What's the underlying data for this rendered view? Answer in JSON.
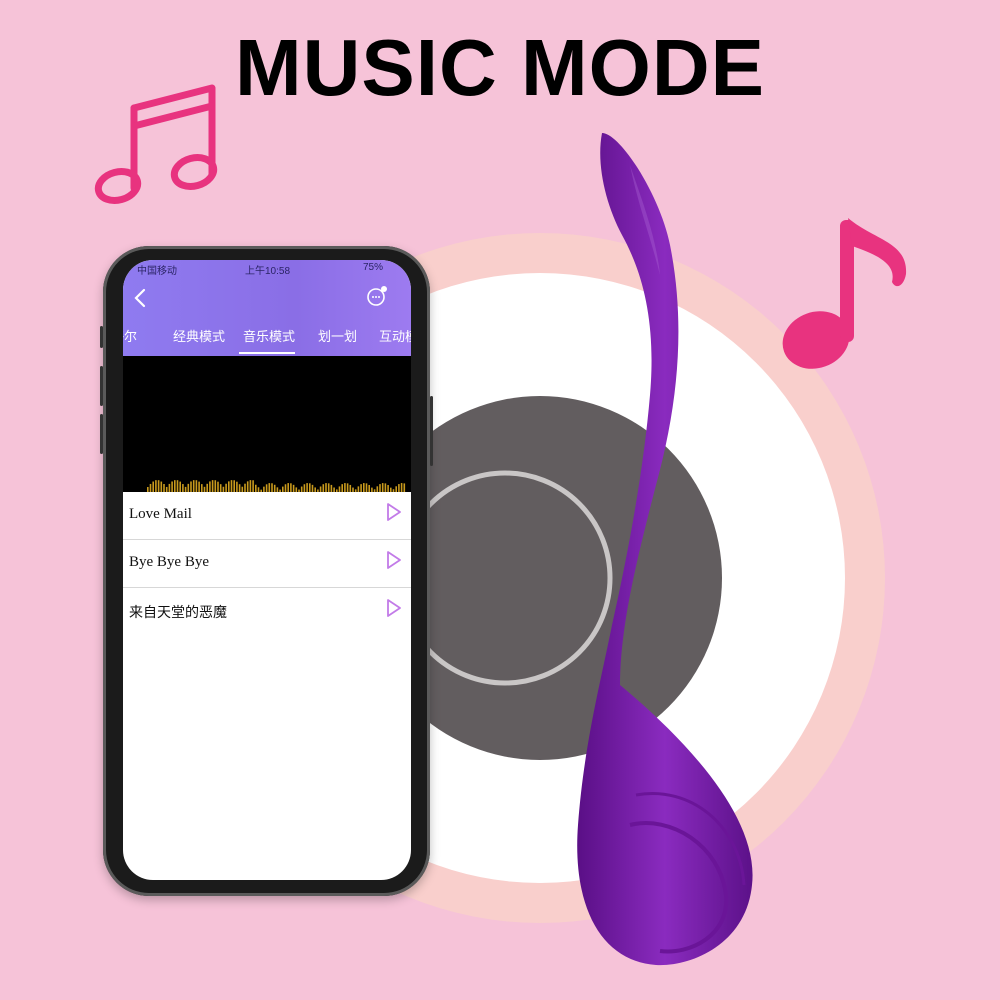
{
  "headline": "MUSIC MODE",
  "icons": {
    "note_left": "beamed-eighth-notes-icon",
    "note_right": "eighth-note-icon",
    "play": "play-triangle-icon",
    "back": "chevron-left-icon",
    "chat": "chat-bubble-icon"
  },
  "colors": {
    "background": "#f6c3d8",
    "note_pink": "#e8337f",
    "toy_purple": "#7a1fa8",
    "app_header": "#8f7bf0",
    "play_icon": "#c27be8"
  },
  "phone": {
    "status": {
      "carrier": "中国移动",
      "time": "上午10:58",
      "battery": "75%"
    },
    "tabs": [
      {
        "label": "铬尔"
      },
      {
        "label": "经典模式"
      },
      {
        "label": "音乐模式"
      },
      {
        "label": "划一划"
      },
      {
        "label": "互动模"
      }
    ],
    "active_tab": "音乐模式",
    "songs": [
      {
        "title": "Love Mail"
      },
      {
        "title": "Bye Bye Bye"
      },
      {
        "title": "来自天堂的恶魔"
      }
    ]
  }
}
